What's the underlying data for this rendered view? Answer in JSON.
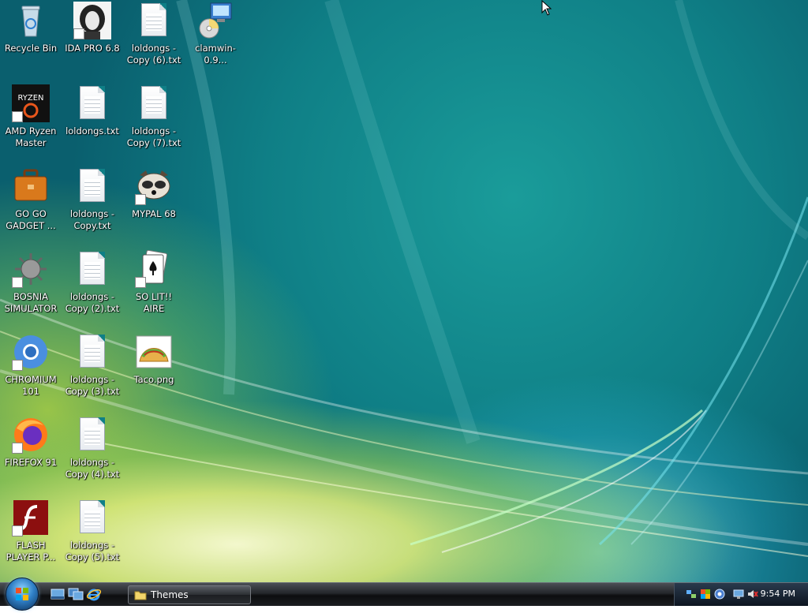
{
  "desktop": {
    "icons": [
      {
        "id": "recycle-bin",
        "label": "Recycle Bin"
      },
      {
        "id": "ida-pro",
        "label": "IDA PRO 6.8"
      },
      {
        "id": "loldongs-copy-6",
        "label": "loldongs -\nCopy (6).txt"
      },
      {
        "id": "clamwin",
        "label": "clamwin-0.9..."
      },
      {
        "id": "amd-ryzen-master",
        "label": "AMD Ryzen\nMaster",
        "logo_text": "RYZEN"
      },
      {
        "id": "loldongs",
        "label": "loldongs.txt"
      },
      {
        "id": "loldongs-copy-7",
        "label": "loldongs -\nCopy (7).txt"
      },
      {
        "id": "go-go-gadget",
        "label": "GO GO\nGADGET ..."
      },
      {
        "id": "loldongs-copy",
        "label": "loldongs -\nCopy.txt"
      },
      {
        "id": "mypal-68",
        "label": "MYPAL 68"
      },
      {
        "id": "bosnia-simulator",
        "label": "BOSNIA\nSIMULATOR"
      },
      {
        "id": "loldongs-copy-2",
        "label": "loldongs -\nCopy (2).txt"
      },
      {
        "id": "solitaire",
        "label": "SO LIT!! AIRE"
      },
      {
        "id": "chromium-101",
        "label": "CHROMIUM\n101"
      },
      {
        "id": "loldongs-copy-3",
        "label": "loldongs -\nCopy (3).txt"
      },
      {
        "id": "taco-png",
        "label": "Taco.png"
      },
      {
        "id": "firefox-91",
        "label": "FIREFOX 91"
      },
      {
        "id": "loldongs-copy-4",
        "label": "loldongs -\nCopy (4).txt"
      },
      {
        "id": "flash-player",
        "label": "FLASH\nPLAYER P..."
      },
      {
        "id": "loldongs-copy-5",
        "label": "loldongs -\nCopy (5).txt"
      }
    ]
  },
  "taskbar": {
    "start_icon": "windows-orb-icon",
    "quick_launch": [
      "show-desktop-icon",
      "switch-windows-icon",
      "internet-explorer-icon"
    ],
    "tasks": [
      {
        "label": "Themes",
        "icon": "folder-icon"
      }
    ],
    "tray_icons": [
      "network-icon",
      "security-icon",
      "update-icon",
      "display-icon",
      "volume-muted-icon"
    ],
    "clock": "9:54 PM"
  },
  "colors": {
    "desktop_teal": "#0f7f86",
    "desktop_glow_yellow": "#e6f078",
    "taskbar_dark": "#1b1d20"
  }
}
